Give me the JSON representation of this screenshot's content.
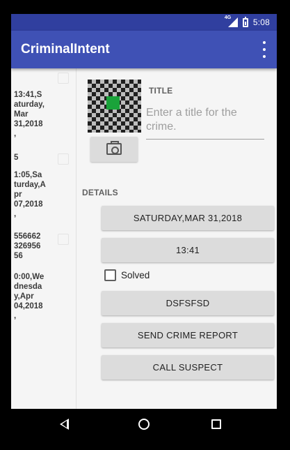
{
  "status_bar": {
    "network": "4G",
    "time": "5:08",
    "icons": [
      "signal-icon",
      "battery-icon"
    ]
  },
  "app_bar": {
    "title": "CriminalIntent",
    "menu_icon": "overflow-menu-icon"
  },
  "crime_list": [
    {
      "text": "13:41,S\naturday,\nMar\n31,2018\n,",
      "solved": false
    },
    {
      "text": "5",
      "solved": false
    },
    {
      "text": "1:05,Sa\nturday,A\npr\n07,2018\n,",
      "solved": false
    },
    {
      "text": "556662\n326956\n56",
      "solved": false
    },
    {
      "text": "0:00,We\ndnesda\ny,Apr\n04,2018\n,",
      "solved": false
    }
  ],
  "detail": {
    "title_label": "TITLE",
    "title_placeholder": "Enter a title for the crime.",
    "title_value": "",
    "details_label": "DETAILS",
    "date_button": "SATURDAY,MAR 31,2018",
    "time_button": "13:41",
    "solved_label": "Solved",
    "solved_checked": false,
    "suspect_button": "DSFSFSD",
    "report_button": "SEND CRIME REPORT",
    "call_button": "CALL SUSPECT"
  },
  "colors": {
    "primary": "#3f51b5",
    "primary_dark": "#303f9f",
    "thumbnail_accent": "#1aa33a"
  }
}
